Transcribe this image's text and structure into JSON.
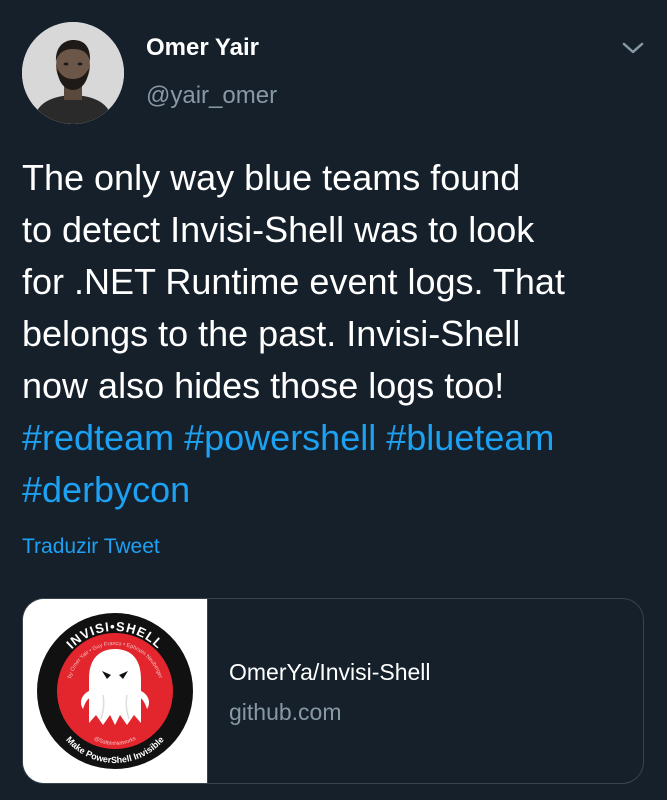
{
  "author": {
    "name": "Omer Yair",
    "handle": "@yair_omer"
  },
  "tweet": {
    "lines": [
      "The only way blue teams found",
      "to detect Invisi-Shell was to look",
      "for .NET Runtime event logs. That",
      "belongs to the past. Invisi-Shell",
      "now also hides those logs too!"
    ],
    "hashtags": [
      "#redteam",
      "#powershell",
      "#blueteam",
      "#derbycon"
    ]
  },
  "translate_label": "Traduzir Tweet",
  "card": {
    "title": "OmerYa/Invisi-Shell",
    "domain": "github.com",
    "logo": {
      "top_text": "INVISI•SHELL",
      "ring_text": "by Omer Yair • Guy Franco • Ephraim Neuberger",
      "inner_bottom_text": "@SafeInNetworks",
      "bottom_text": "Make PowerShell Invisible"
    }
  },
  "colors": {
    "background": "#15202b",
    "text": "#ffffff",
    "muted": "#8899a6",
    "accent": "#1da1f2",
    "border": "#38444d"
  },
  "icons": {
    "menu": "chevron-down-icon",
    "logo": "ghost-icon"
  }
}
